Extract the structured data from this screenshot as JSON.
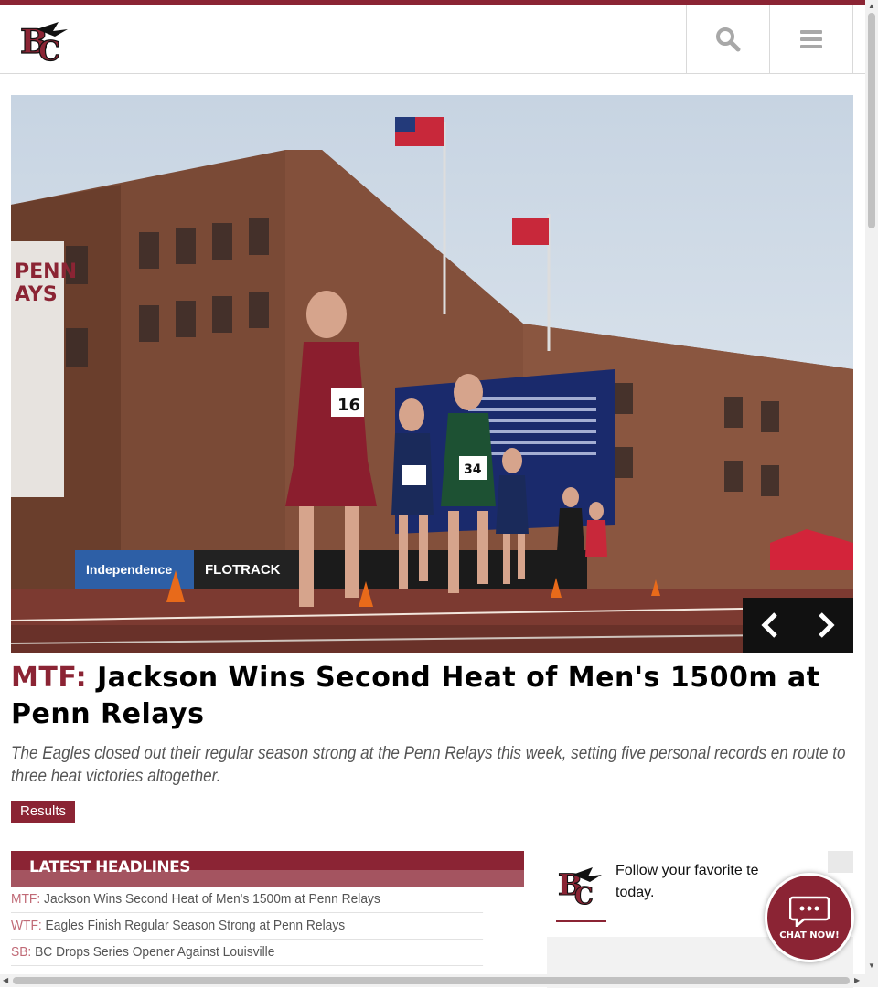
{
  "header": {
    "logo_text": "BC",
    "search_icon": "search-icon",
    "menu_icon": "hamburger-menu-icon",
    "brand_color": "#8b2434"
  },
  "hero": {
    "image_alt": "Runners racing at Penn Relays, Franklin Field",
    "prev_icon": "chevron-left-icon",
    "next_icon": "chevron-right-icon"
  },
  "story": {
    "tag": "MTF:",
    "title": "Jackson Wins Second Heat of Men's 1500m at Penn Relays",
    "summary": "The Eagles closed out their regular season strong at the Penn Relays this week, setting five personal records en route to three heat victories altogether.",
    "results_label": "Results"
  },
  "latest": {
    "heading": "LATEST HEADLINES",
    "items": [
      {
        "sport": "MTF:",
        "title": "Jackson Wins Second Heat of Men's 1500m at Penn Relays"
      },
      {
        "sport": "WTF:",
        "title": "Eagles Finish Regular Season Strong at Penn Relays"
      },
      {
        "sport": "SB:",
        "title": "BC Drops Series Opener Against Louisville"
      }
    ]
  },
  "follow": {
    "text_line1": "Follow your favorite te",
    "text_line2": "today."
  },
  "chat": {
    "label": "CHAT NOW!"
  }
}
